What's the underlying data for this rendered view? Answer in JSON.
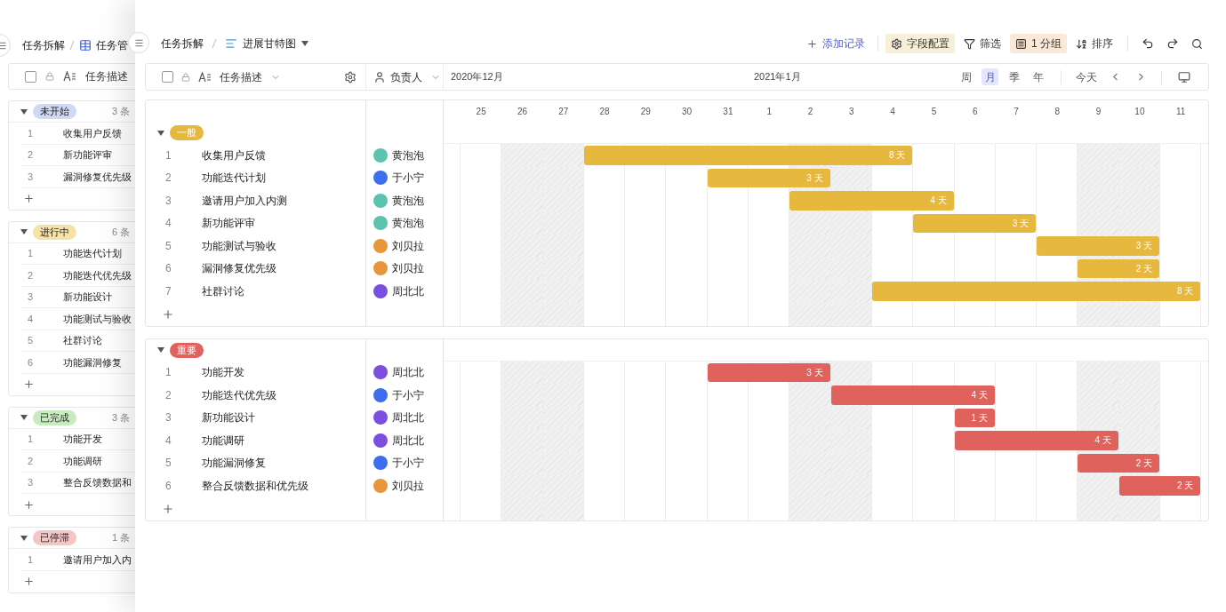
{
  "background_window": {
    "breadcrumb": [
      "任务拆解",
      "任务管"
    ],
    "header_checked": false,
    "column_header": "任务描述",
    "groups": [
      {
        "label": "未开始",
        "color": "#cfd8f7",
        "count": "3 条",
        "rows": [
          {
            "index": "1",
            "title": "收集用户反馈"
          },
          {
            "index": "2",
            "title": "新功能评审"
          },
          {
            "index": "3",
            "title": "漏洞修复优先级"
          }
        ]
      },
      {
        "label": "进行中",
        "color": "#f6e2a6",
        "count": "6 条",
        "rows": [
          {
            "index": "1",
            "title": "功能迭代计划"
          },
          {
            "index": "2",
            "title": "功能迭代优先级"
          },
          {
            "index": "3",
            "title": "新功能设计"
          },
          {
            "index": "4",
            "title": "功能测试与验收"
          },
          {
            "index": "5",
            "title": "社群讨论"
          },
          {
            "index": "6",
            "title": "功能漏洞修复"
          }
        ]
      },
      {
        "label": "已完成",
        "color": "#c8ecc0",
        "count": "3 条",
        "rows": [
          {
            "index": "1",
            "title": "功能开发"
          },
          {
            "index": "2",
            "title": "功能调研"
          },
          {
            "index": "3",
            "title": "整合反馈数据和"
          }
        ]
      },
      {
        "label": "已停滞",
        "color": "#f5c6c6",
        "count": "1 条",
        "rows": [
          {
            "index": "1",
            "title": "邀请用户加入内"
          }
        ]
      }
    ]
  },
  "breadcrumb": {
    "parent": "任务拆解",
    "view": "进展甘特图"
  },
  "toolbar": [
    {
      "kind": "add",
      "label": "添加记录",
      "active": false
    },
    {
      "kind": "fields",
      "label": "字段配置",
      "active": true
    },
    {
      "kind": "filter",
      "label": "筛选",
      "active": false
    },
    {
      "kind": "group",
      "label": "1 分组",
      "active": true
    },
    {
      "kind": "sort",
      "label": "排序",
      "active": false
    }
  ],
  "header_checked": false,
  "columns": [
    "任务描述",
    "负责人"
  ],
  "months": [
    "2020年12月",
    "2021年1月"
  ],
  "scales": [
    {
      "label": "周",
      "selected": false
    },
    {
      "label": "月",
      "selected": true
    },
    {
      "label": "季",
      "selected": false
    },
    {
      "label": "年",
      "selected": false
    }
  ],
  "today": "今天",
  "timeline": {
    "days": [
      {
        "label": "25",
        "weekend": false
      },
      {
        "label": "26",
        "weekend": true
      },
      {
        "label": "27",
        "weekend": true
      },
      {
        "label": "28",
        "weekend": false
      },
      {
        "label": "29",
        "weekend": false
      },
      {
        "label": "30",
        "weekend": false
      },
      {
        "label": "31",
        "weekend": false
      },
      {
        "label": "1",
        "weekend": false
      },
      {
        "label": "2",
        "weekend": true
      },
      {
        "label": "3",
        "weekend": true
      },
      {
        "label": "4",
        "weekend": false
      },
      {
        "label": "5",
        "weekend": false
      },
      {
        "label": "6",
        "weekend": false
      },
      {
        "label": "7",
        "weekend": false
      },
      {
        "label": "8",
        "weekend": false
      },
      {
        "label": "9",
        "weekend": true
      },
      {
        "label": "10",
        "weekend": true
      },
      {
        "label": "11",
        "weekend": false
      }
    ]
  },
  "groups": [
    {
      "label": "一般",
      "color": "#e6b83e",
      "rows": [
        {
          "index": "1",
          "title": "收集用户反馈",
          "assignee": {
            "name": "黄泡泡",
            "color": "#5cc3ae"
          },
          "duration": "8 天",
          "bar_days": [
            false,
            false,
            false,
            true,
            true,
            true,
            true,
            true,
            true,
            true,
            true,
            false,
            false,
            false,
            false,
            false,
            false,
            false
          ]
        },
        {
          "index": "2",
          "title": "功能迭代计划",
          "assignee": {
            "name": "于小宁",
            "color": "#3d6ef0"
          },
          "duration": "3 天",
          "bar_days": [
            false,
            false,
            false,
            false,
            false,
            false,
            true,
            true,
            true,
            false,
            false,
            false,
            false,
            false,
            false,
            false,
            false,
            false
          ]
        },
        {
          "index": "3",
          "title": "邀请用户加入内测",
          "assignee": {
            "name": "黄泡泡",
            "color": "#5cc3ae"
          },
          "duration": "4 天",
          "bar_days": [
            false,
            false,
            false,
            false,
            false,
            false,
            false,
            false,
            true,
            true,
            true,
            true,
            false,
            false,
            false,
            false,
            false,
            false
          ]
        },
        {
          "index": "4",
          "title": "新功能评审",
          "assignee": {
            "name": "黄泡泡",
            "color": "#5cc3ae"
          },
          "duration": "3 天",
          "bar_days": [
            false,
            false,
            false,
            false,
            false,
            false,
            false,
            false,
            false,
            false,
            false,
            true,
            true,
            true,
            false,
            false,
            false,
            false
          ]
        },
        {
          "index": "5",
          "title": "功能测试与验收",
          "assignee": {
            "name": "刘贝拉",
            "color": "#e8963a"
          },
          "duration": "3 天",
          "bar_days": [
            false,
            false,
            false,
            false,
            false,
            false,
            false,
            false,
            false,
            false,
            false,
            false,
            false,
            false,
            true,
            true,
            true,
            false
          ]
        },
        {
          "index": "6",
          "title": "漏洞修复优先级",
          "assignee": {
            "name": "刘贝拉",
            "color": "#e8963a"
          },
          "duration": "2 天",
          "bar_days": [
            false,
            false,
            false,
            false,
            false,
            false,
            false,
            false,
            false,
            false,
            false,
            false,
            false,
            false,
            false,
            true,
            true,
            false
          ]
        },
        {
          "index": "7",
          "title": "社群讨论",
          "assignee": {
            "name": "周北北",
            "color": "#7b4fe0"
          },
          "duration": "8 天",
          "bar_days": [
            false,
            false,
            false,
            false,
            false,
            false,
            false,
            false,
            false,
            false,
            true,
            true,
            true,
            true,
            true,
            true,
            true,
            true
          ]
        }
      ]
    },
    {
      "label": "重要",
      "color": "#e0625c",
      "rows": [
        {
          "index": "1",
          "title": "功能开发",
          "assignee": {
            "name": "周北北",
            "color": "#7b4fe0"
          },
          "duration": "3 天",
          "bar_days": [
            false,
            false,
            false,
            false,
            false,
            false,
            true,
            true,
            true,
            false,
            false,
            false,
            false,
            false,
            false,
            false,
            false,
            false
          ]
        },
        {
          "index": "2",
          "title": "功能迭代优先级",
          "assignee": {
            "name": "于小宁",
            "color": "#3d6ef0"
          },
          "duration": "4 天",
          "bar_days": [
            false,
            false,
            false,
            false,
            false,
            false,
            false,
            false,
            false,
            true,
            true,
            true,
            true,
            false,
            false,
            false,
            false,
            false
          ]
        },
        {
          "index": "3",
          "title": "新功能设计",
          "assignee": {
            "name": "周北北",
            "color": "#7b4fe0"
          },
          "duration": "1 天",
          "bar_days": [
            false,
            false,
            false,
            false,
            false,
            false,
            false,
            false,
            false,
            false,
            false,
            false,
            true,
            false,
            false,
            false,
            false,
            false
          ]
        },
        {
          "index": "4",
          "title": "功能调研",
          "assignee": {
            "name": "周北北",
            "color": "#7b4fe0"
          },
          "duration": "4 天",
          "bar_days": [
            false,
            false,
            false,
            false,
            false,
            false,
            false,
            false,
            false,
            false,
            false,
            false,
            true,
            true,
            true,
            true,
            false,
            false
          ]
        },
        {
          "index": "5",
          "title": "功能漏洞修复",
          "assignee": {
            "name": "于小宁",
            "color": "#3d6ef0"
          },
          "duration": "2 天",
          "bar_days": [
            false,
            false,
            false,
            false,
            false,
            false,
            false,
            false,
            false,
            false,
            false,
            false,
            false,
            false,
            false,
            true,
            true,
            false
          ]
        },
        {
          "index": "6",
          "title": "整合反馈数据和优先级",
          "assignee": {
            "name": "刘贝拉",
            "color": "#e8963a"
          },
          "duration": "2 天",
          "bar_days": [
            false,
            false,
            false,
            false,
            false,
            false,
            false,
            false,
            false,
            false,
            false,
            false,
            false,
            false,
            false,
            false,
            true,
            true
          ]
        }
      ]
    }
  ]
}
